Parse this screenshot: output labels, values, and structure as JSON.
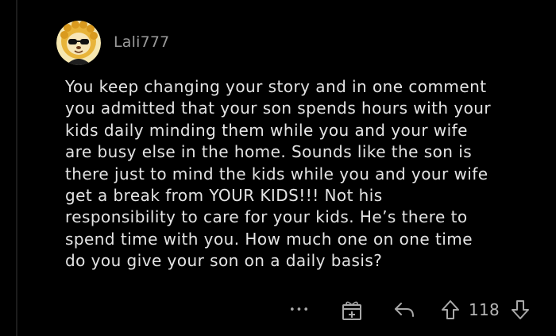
{
  "comment": {
    "username": "Lali777",
    "avatar_icon": "lion-avatar-icon",
    "body_lines": [
      "You keep changing your story and in one comment",
      "you admitted that your son spends hours with your",
      "kids daily minding them while you and your wife",
      "are busy else in the home. Sounds like the son is",
      "there just to mind the kids while you and your wife",
      "get a break from YOUR KIDS!!! Not his",
      "responsibility to care for your kids. He’s there to",
      "spend time with you. How much one on one time",
      "do you give your son on a daily basis?"
    ]
  },
  "actions": {
    "more_label": "•••",
    "award_icon": "gift-icon",
    "reply_icon": "reply-arrow-icon",
    "upvote_icon": "upvote-arrow-icon",
    "score": "118",
    "downvote_icon": "downvote-arrow-icon"
  },
  "colors": {
    "background": "#000000",
    "text": "#e4e4e4",
    "muted": "#9a9a9a",
    "avatar_yellow": "#f2c94c"
  }
}
